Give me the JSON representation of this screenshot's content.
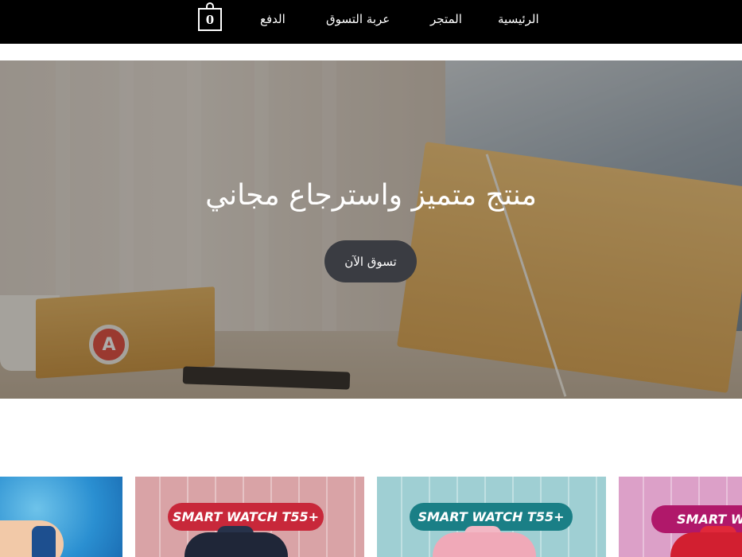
{
  "header": {
    "cart_count": "0",
    "nav": [
      {
        "label": "الرئيسية"
      },
      {
        "label": "المتجر"
      },
      {
        "label": "عربة التسوق"
      },
      {
        "label": "الدفع"
      }
    ]
  },
  "hero": {
    "title": "منتج متميز واسترجاع مجاني",
    "button_label": "تسوق الآن",
    "badge_letter": "A"
  },
  "products": [
    {
      "name": "blue-lifestyle"
    },
    {
      "label": "SMART WATCH T55+",
      "background": "#d9a3a6",
      "pill_color": "#c8283a",
      "watch_color": "#27324a"
    },
    {
      "label": "SMART WATCH T55+",
      "background": "#9fcfd3",
      "pill_color": "#1a7f86",
      "watch_color": "#f2b7c4"
    },
    {
      "label": "SMART WA",
      "background": "#dca0c8",
      "pill_color": "#b0186a",
      "watch_color": "#e0283a"
    }
  ],
  "colors": {
    "topbar": "#000000",
    "hero_button": "#3a3c42"
  }
}
